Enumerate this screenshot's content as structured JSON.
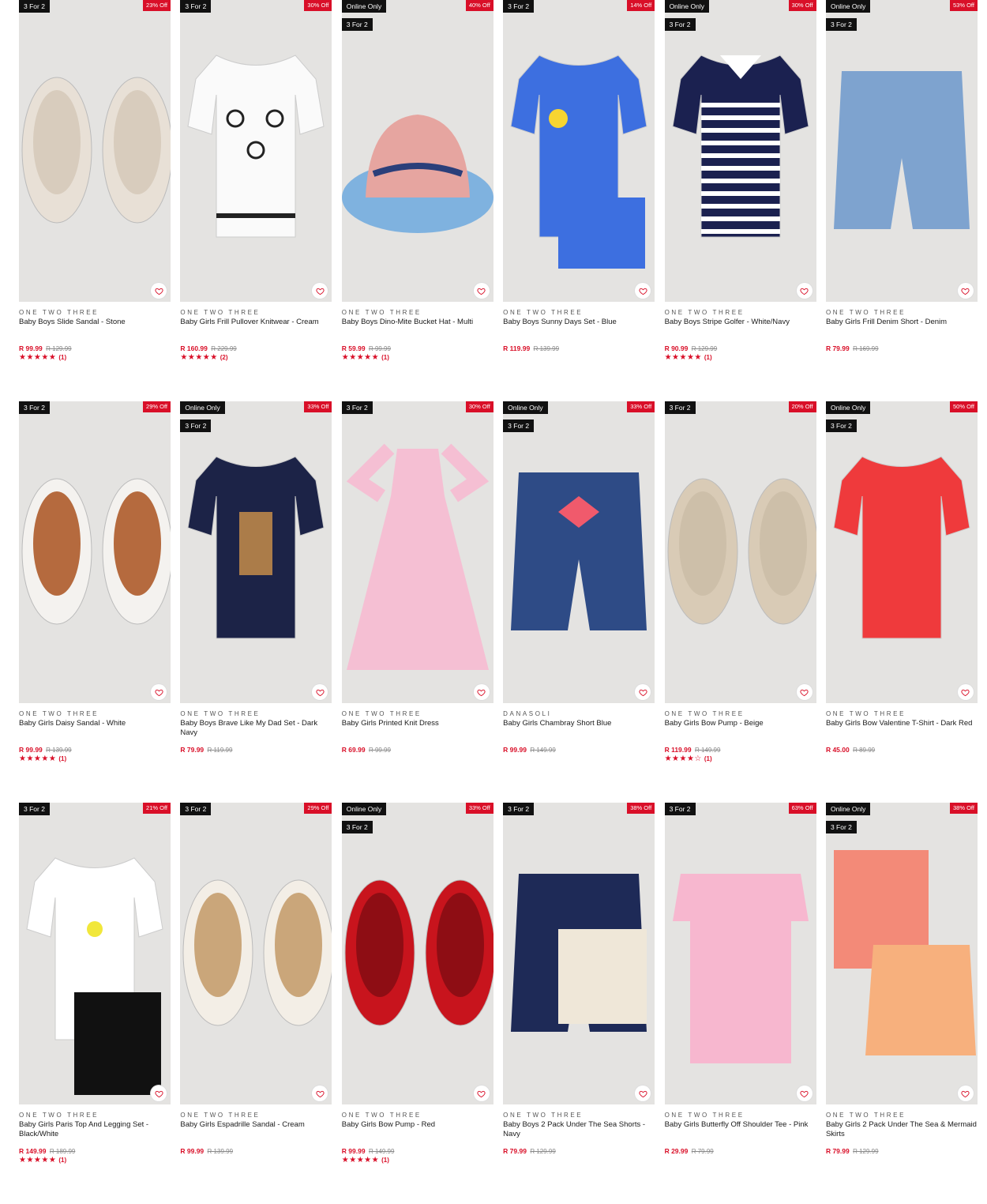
{
  "products": [
    {
      "tags": [
        "3 For 2"
      ],
      "discount": "23% Off",
      "brand": "ONE TWO THREE",
      "title": "Baby Boys Slide Sandal - Stone",
      "price": "R 99.99",
      "was": "R 129.99",
      "stars": "★★★★★",
      "count": "(1)",
      "art": "slides",
      "color": "#e8e0d6"
    },
    {
      "tags": [
        "3 For 2"
      ],
      "discount": "30% Off",
      "brand": "ONE TWO THREE",
      "title": "Baby Girls Frill Pullover Knitwear - Cream",
      "price": "R 160.99",
      "was": "R 229.99",
      "stars": "★★★★★",
      "count": "(2)",
      "art": "knit",
      "color": "#fafafa"
    },
    {
      "tags": [
        "Online Only",
        "3 For 2"
      ],
      "discount": "40% Off",
      "brand": "ONE TWO THREE",
      "title": "Baby Boys Dino-Mite Bucket Hat - Multi",
      "price": "R 59.99",
      "was": "R 99.99",
      "stars": "★★★★★",
      "count": "(1)",
      "art": "hat",
      "color": "#7fb2df"
    },
    {
      "tags": [
        "3 For 2"
      ],
      "discount": "14% Off",
      "brand": "ONE TWO THREE",
      "title": "Baby Boys Sunny Days Set - Blue",
      "price": "R 119.99",
      "was": "R 139.99",
      "stars": "",
      "count": "",
      "art": "set",
      "color": "#3d6fe0"
    },
    {
      "tags": [
        "Online Only",
        "3 For 2"
      ],
      "discount": "30% Off",
      "brand": "ONE TWO THREE",
      "title": "Baby Boys Stripe Golfer - White/Navy",
      "price": "R 90.99",
      "was": "R 129.99",
      "stars": "★★★★★",
      "count": "(1)",
      "art": "golfer",
      "color": "#1b2150"
    },
    {
      "tags": [
        "Online Only",
        "3 For 2"
      ],
      "discount": "53% Off",
      "brand": "ONE TWO THREE",
      "title": "Baby Girls Frill Denim Short - Denim",
      "price": "R 79.99",
      "was": "R 169.99",
      "stars": "",
      "count": "",
      "art": "shorts",
      "color": "#7ea3cf"
    },
    {
      "tags": [
        "3 For 2"
      ],
      "discount": "29% Off",
      "brand": "ONE TWO THREE",
      "title": "Baby Girls Daisy Sandal - White",
      "price": "R 99.99",
      "was": "R 139.99",
      "stars": "★★★★★",
      "count": "(1)",
      "art": "sandals",
      "color": "#f4f2ef"
    },
    {
      "tags": [
        "Online Only",
        "3 For 2"
      ],
      "discount": "33% Off",
      "brand": "ONE TWO THREE",
      "title": "Baby Boys Brave Like My Dad Set - Dark Navy",
      "price": "R 79.99",
      "was": "R 119.99",
      "stars": "",
      "count": "",
      "art": "tee",
      "color": "#1c2347"
    },
    {
      "tags": [
        "3 For 2"
      ],
      "discount": "30% Off",
      "brand": "ONE TWO THREE",
      "title": "Baby Girls Printed Knit Dress",
      "price": "R 69.99",
      "was": "R 99.99",
      "stars": "",
      "count": "",
      "art": "dress",
      "color": "#f5bfd3"
    },
    {
      "tags": [
        "Online Only",
        "3 For 2"
      ],
      "discount": "33% Off",
      "brand": "DANASOLI",
      "title": "Baby Girls Chambray Short Blue",
      "price": "R 99.99",
      "was": "R 149.99",
      "stars": "",
      "count": "",
      "art": "chambray",
      "color": "#2e4b86"
    },
    {
      "tags": [
        "3 For 2"
      ],
      "discount": "20% Off",
      "brand": "ONE TWO THREE",
      "title": "Baby Girls Bow Pump - Beige",
      "price": "R 119.99",
      "was": "R 149.99",
      "stars": "★★★★☆",
      "count": "(1)",
      "art": "pumps",
      "color": "#d9cbb6"
    },
    {
      "tags": [
        "Online Only",
        "3 For 2"
      ],
      "discount": "50% Off",
      "brand": "ONE TWO THREE",
      "title": "Baby Girls Bow Valentine T-Shirt - Dark Red",
      "price": "R 45.00",
      "was": "R 89.99",
      "stars": "",
      "count": "",
      "art": "redtee",
      "color": "#ef3a3c"
    },
    {
      "tags": [
        "3 For 2"
      ],
      "discount": "21% Off",
      "brand": "ONE TWO THREE",
      "title": "Baby Girls Paris Top And Legging Set - Black/White",
      "price": "R 149.99",
      "was": "R 189.99",
      "stars": "★★★★★",
      "count": "(1)",
      "art": "paris",
      "color": "#ffffff"
    },
    {
      "tags": [
        "3 For 2"
      ],
      "discount": "29% Off",
      "brand": "ONE TWO THREE",
      "title": "Baby Girls Espadrille Sandal - Cream",
      "price": "R 99.99",
      "was": "R 139.99",
      "stars": "",
      "count": "",
      "art": "espadrille",
      "color": "#f3eee6"
    },
    {
      "tags": [
        "Online Only",
        "3 For 2"
      ],
      "discount": "33% Off",
      "brand": "ONE TWO THREE",
      "title": "Baby Girls Bow Pump - Red",
      "price": "R 99.99",
      "was": "R 149.99",
      "stars": "★★★★★",
      "count": "(1)",
      "art": "redpumps",
      "color": "#c8141d"
    },
    {
      "tags": [
        "3 For 2"
      ],
      "discount": "38% Off",
      "brand": "ONE TWO THREE",
      "title": "Baby Boys 2 Pack Under The Sea Shorts - Navy",
      "price": "R 79.99",
      "was": "R 129.99",
      "stars": "",
      "count": "",
      "art": "seashorts",
      "color": "#1e2a57"
    },
    {
      "tags": [
        "3 For 2"
      ],
      "discount": "63% Off",
      "brand": "ONE TWO THREE",
      "title": "Baby Girls Butterfly Off Shoulder Tee - Pink",
      "price": "R 29.99",
      "was": "R 79.99",
      "stars": "",
      "count": "",
      "art": "pinktop",
      "color": "#f7b7cf"
    },
    {
      "tags": [
        "Online Only",
        "3 For 2"
      ],
      "discount": "38% Off",
      "brand": "ONE TWO THREE",
      "title": "Baby Girls 2 Pack Under The Sea & Mermaid Skirts",
      "price": "R 79.99",
      "was": "R 129.99",
      "stars": "",
      "count": "",
      "art": "skirts",
      "color": "#f38a78"
    }
  ]
}
